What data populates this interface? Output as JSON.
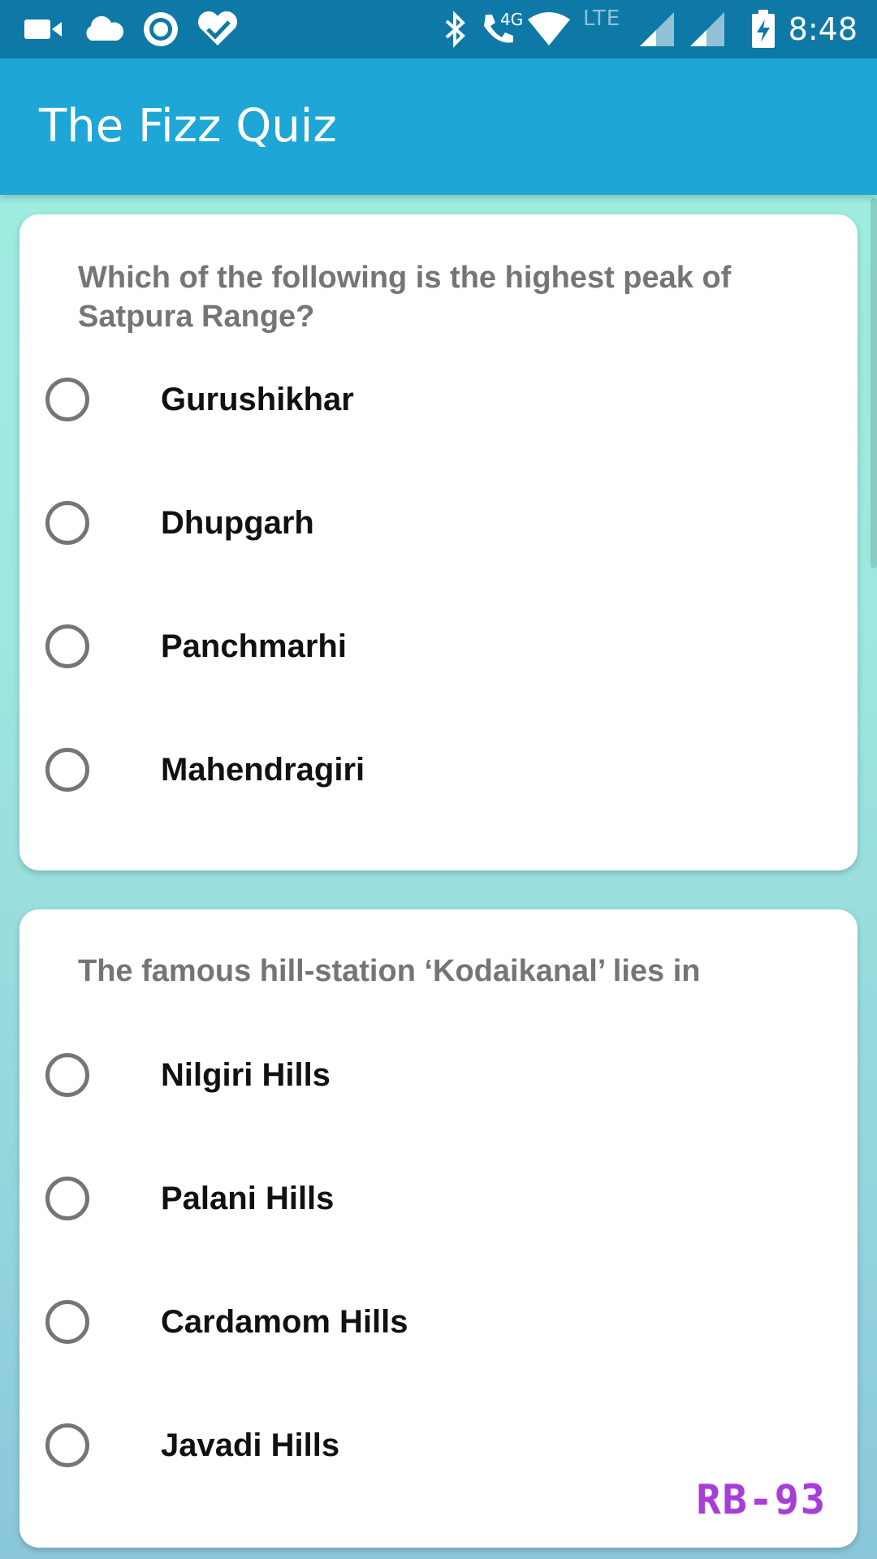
{
  "status_bar": {
    "time": "8:48",
    "network_label": "LTE",
    "call_label": "4G",
    "left_icons": [
      "video-camera-icon",
      "cloud-icon",
      "target-circle-icon",
      "heart-check-icon"
    ],
    "right_icons": [
      "bluetooth-icon",
      "wifi-call-icon",
      "wifi-icon",
      "signal-icon",
      "signal-icon",
      "battery-charging-icon"
    ]
  },
  "app_bar": {
    "title": "The Fizz Quiz"
  },
  "questions": [
    {
      "text": "Which of the following is the highest peak of Satpura Range?",
      "options": [
        "Gurushikhar",
        "Dhupgarh",
        "Panchmarhi",
        "Mahendragiri"
      ]
    },
    {
      "text": "The famous hill-station ‘Kodaikanal’ lies in",
      "options": [
        "Nilgiri Hills",
        "Palani Hills",
        "Cardamom Hills",
        "Javadi Hills"
      ]
    }
  ],
  "watermark": "RB-93",
  "colors": {
    "status_bar": "#0e79a6",
    "app_bar": "#1da6d6",
    "background": "#9ee6df",
    "radio_border": "#757575",
    "watermark": "#a53fd6"
  }
}
